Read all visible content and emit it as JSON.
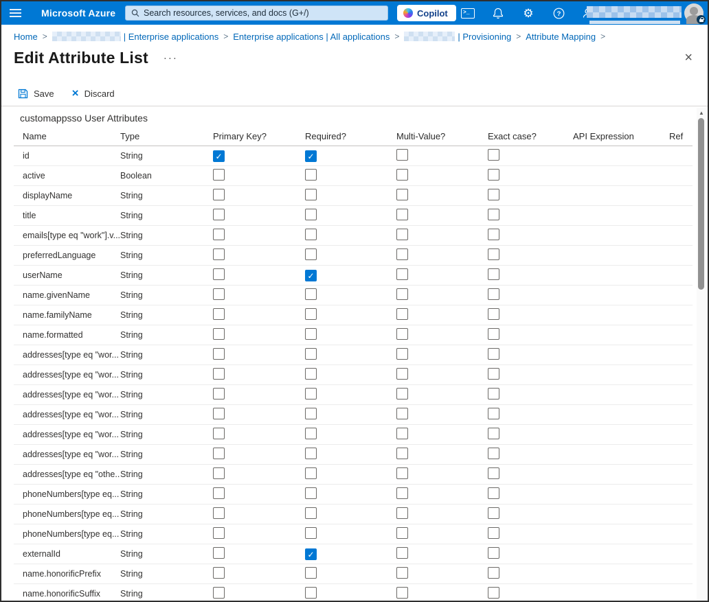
{
  "topbar": {
    "brand": "Microsoft Azure",
    "search": {
      "placeholder": "Search resources, services, and docs (G+/)"
    },
    "copilot_label": "Copilot",
    "cloudshell_glyph": ">_"
  },
  "breadcrumb": {
    "separator": ">",
    "items": [
      {
        "label": "Home",
        "redacted_prefix": false
      },
      {
        "label": "| Enterprise applications",
        "redacted_prefix": true
      },
      {
        "label": "Enterprise applications | All applications",
        "redacted_prefix": false
      },
      {
        "label": "| Provisioning",
        "redacted_prefix": true
      },
      {
        "label": "Attribute Mapping",
        "redacted_prefix": false
      }
    ]
  },
  "page": {
    "title": "Edit Attribute List",
    "more_glyph": "···",
    "close_glyph": "×"
  },
  "toolbar": {
    "save_label": "Save",
    "discard_label": "Discard",
    "discard_glyph": "×"
  },
  "attributes_table": {
    "section_title": "customappsso User Attributes",
    "columns": [
      "Name",
      "Type",
      "Primary Key?",
      "Required?",
      "Multi-Value?",
      "Exact case?",
      "API Expression",
      "Ref"
    ],
    "check_glyph": "✓",
    "rows": [
      {
        "name": "id",
        "type": "String",
        "primary_key": true,
        "required": true,
        "multi_value": false,
        "exact_case": false
      },
      {
        "name": "active",
        "type": "Boolean",
        "primary_key": false,
        "required": false,
        "multi_value": false,
        "exact_case": false
      },
      {
        "name": "displayName",
        "type": "String",
        "primary_key": false,
        "required": false,
        "multi_value": false,
        "exact_case": false
      },
      {
        "name": "title",
        "type": "String",
        "primary_key": false,
        "required": false,
        "multi_value": false,
        "exact_case": false
      },
      {
        "name": "emails[type eq \"work\"].v...",
        "type": "String",
        "primary_key": false,
        "required": false,
        "multi_value": false,
        "exact_case": false
      },
      {
        "name": "preferredLanguage",
        "type": "String",
        "primary_key": false,
        "required": false,
        "multi_value": false,
        "exact_case": false
      },
      {
        "name": "userName",
        "type": "String",
        "primary_key": false,
        "required": true,
        "multi_value": false,
        "exact_case": false
      },
      {
        "name": "name.givenName",
        "type": "String",
        "primary_key": false,
        "required": false,
        "multi_value": false,
        "exact_case": false
      },
      {
        "name": "name.familyName",
        "type": "String",
        "primary_key": false,
        "required": false,
        "multi_value": false,
        "exact_case": false
      },
      {
        "name": "name.formatted",
        "type": "String",
        "primary_key": false,
        "required": false,
        "multi_value": false,
        "exact_case": false
      },
      {
        "name": "addresses[type eq \"wor...",
        "type": "String",
        "primary_key": false,
        "required": false,
        "multi_value": false,
        "exact_case": false
      },
      {
        "name": "addresses[type eq \"wor...",
        "type": "String",
        "primary_key": false,
        "required": false,
        "multi_value": false,
        "exact_case": false
      },
      {
        "name": "addresses[type eq \"wor...",
        "type": "String",
        "primary_key": false,
        "required": false,
        "multi_value": false,
        "exact_case": false
      },
      {
        "name": "addresses[type eq \"wor...",
        "type": "String",
        "primary_key": false,
        "required": false,
        "multi_value": false,
        "exact_case": false
      },
      {
        "name": "addresses[type eq \"wor...",
        "type": "String",
        "primary_key": false,
        "required": false,
        "multi_value": false,
        "exact_case": false
      },
      {
        "name": "addresses[type eq \"wor...",
        "type": "String",
        "primary_key": false,
        "required": false,
        "multi_value": false,
        "exact_case": false
      },
      {
        "name": "addresses[type eq \"othe...",
        "type": "String",
        "primary_key": false,
        "required": false,
        "multi_value": false,
        "exact_case": false
      },
      {
        "name": "phoneNumbers[type eq...",
        "type": "String",
        "primary_key": false,
        "required": false,
        "multi_value": false,
        "exact_case": false
      },
      {
        "name": "phoneNumbers[type eq...",
        "type": "String",
        "primary_key": false,
        "required": false,
        "multi_value": false,
        "exact_case": false
      },
      {
        "name": "phoneNumbers[type eq...",
        "type": "String",
        "primary_key": false,
        "required": false,
        "multi_value": false,
        "exact_case": false
      },
      {
        "name": "externalId",
        "type": "String",
        "primary_key": false,
        "required": true,
        "multi_value": false,
        "exact_case": false
      },
      {
        "name": "name.honorificPrefix",
        "type": "String",
        "primary_key": false,
        "required": false,
        "multi_value": false,
        "exact_case": false
      },
      {
        "name": "name.honorificSuffix",
        "type": "String",
        "primary_key": false,
        "required": false,
        "multi_value": false,
        "exact_case": false
      }
    ]
  }
}
